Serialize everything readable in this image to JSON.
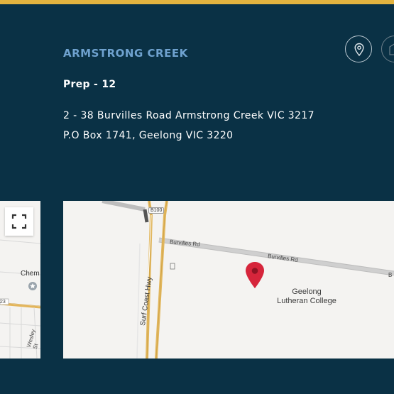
{
  "campus": {
    "name": "ARMSTRONG CREEK",
    "years": "Prep - 12",
    "address_line1": "2 - 38 Burvilles Road Armstrong Creek VIC 3217",
    "address_line2": "P.O Box 1741, Geelong VIC 3220"
  },
  "actions": {
    "location_icon": "map-pin-icon",
    "email_icon": "mail-icon"
  },
  "map_right": {
    "route_badge": "B100",
    "road_label_1": "Burvilles Rd",
    "road_label_2": "Burvilles Rd",
    "highway_label": "Surf Coast Hwy",
    "place_label_line1": "Geelong",
    "place_label_line2": "Lutheran College",
    "edge_badge": "B"
  },
  "map_left": {
    "place_label": "Chem",
    "road_label": "Wesley St",
    "route_badge": "23",
    "fullscreen_icon": "fullscreen-icon"
  },
  "colors": {
    "background": "#0a3145",
    "accent_bar": "#e3b33f",
    "campus_heading": "#6fa2cf",
    "marker": "#d6253b"
  }
}
